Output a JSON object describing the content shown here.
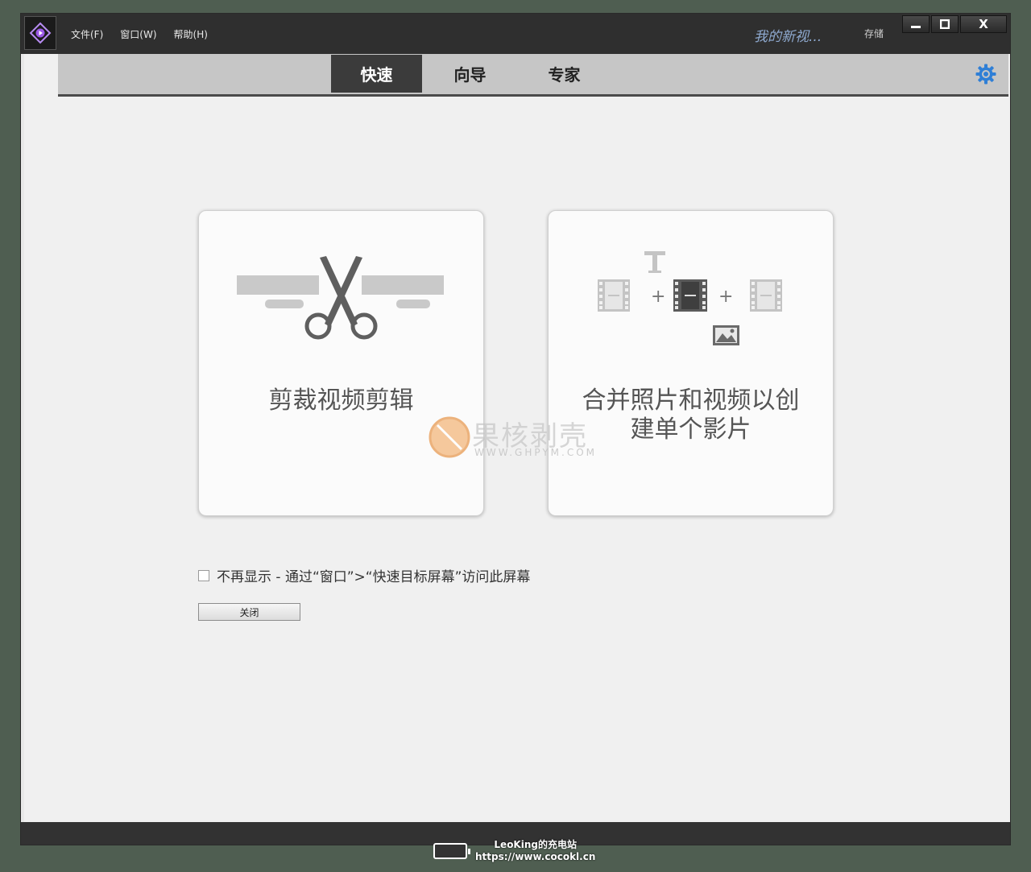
{
  "window": {
    "menu": [
      "文件(F)",
      "窗口(W)",
      "帮助(H)"
    ],
    "project_title": "我的新视...",
    "save_label": "存储",
    "controls": {
      "minimize": "minimize",
      "maximize": "maximize",
      "close": "X"
    }
  },
  "tabs": [
    {
      "label": "快速",
      "active": true
    },
    {
      "label": "向导",
      "active": false
    },
    {
      "label": "专家",
      "active": false
    }
  ],
  "cards": [
    {
      "label": "剪裁视频剪辑",
      "icon": "scissors-trim-icon"
    },
    {
      "label_line1": "合并照片和视频以创",
      "label_line2": "建单个影片",
      "icon": "merge-media-icon"
    }
  ],
  "checkbox": {
    "label": "不再显示 - 通过“窗口”>“快速目标屏幕”访问此屏幕",
    "checked": false
  },
  "close_button": "关闭",
  "watermark": {
    "title": "果核剥壳",
    "url": "WWW.GHPYM.COM"
  },
  "credit": {
    "line1": "LeoKing的充电站",
    "line2": "https://www.cocokl.cn"
  },
  "colors": {
    "accent_purple": "#8a2be2",
    "gear_blue": "#2f7fd6",
    "titlebar": "#2f2f2f"
  }
}
